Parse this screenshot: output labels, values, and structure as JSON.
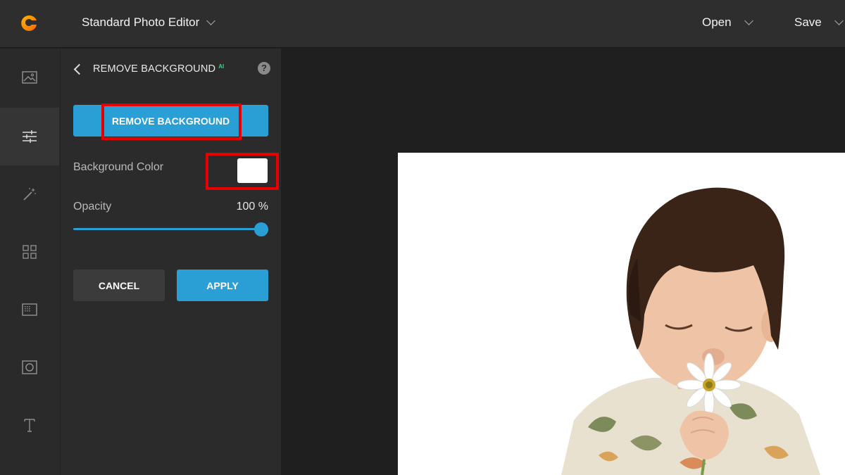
{
  "header": {
    "app_title": "Standard Photo Editor",
    "open_label": "Open",
    "save_label": "Save",
    "logo_icon": "canva-c-logo-icon"
  },
  "rail": {
    "items": [
      {
        "icon": "image-icon",
        "active": false
      },
      {
        "icon": "adjust-sliders-icon",
        "active": true
      },
      {
        "icon": "magic-wand-icon",
        "active": false
      },
      {
        "icon": "grid-icon",
        "active": false
      },
      {
        "icon": "frame-texture-icon",
        "active": false
      },
      {
        "icon": "vignette-frame-icon",
        "active": false
      },
      {
        "icon": "text-icon",
        "active": false
      }
    ]
  },
  "panel": {
    "title": "REMOVE BACKGROUND",
    "ai_badge": "AI",
    "help": "?",
    "remove_button": "REMOVE BACKGROUND",
    "bg_color_label": "Background Color",
    "bg_color_value": "#ffffff",
    "opacity_label": "Opacity",
    "opacity_value": "100 %",
    "opacity_fraction": 1.0,
    "cancel_label": "CANCEL",
    "apply_label": "APPLY"
  },
  "colors": {
    "accent": "#2a9fd6",
    "highlight": "#e60000",
    "ai_badge": "#3fd18a"
  }
}
